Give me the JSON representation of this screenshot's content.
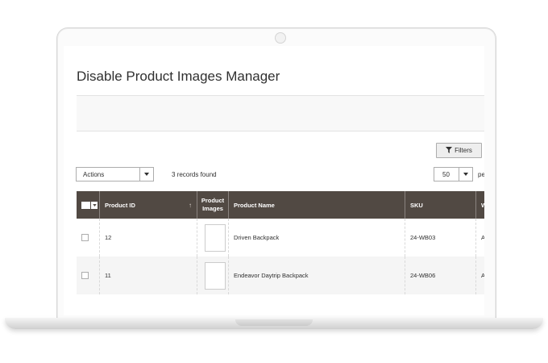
{
  "page": {
    "title": "Disable Product Images Manager"
  },
  "toolbar": {
    "filters_label": "Filters",
    "actions_value": "Actions",
    "records_text": "3 records found",
    "per_page_value": "50",
    "per_page_label": "pe"
  },
  "grid": {
    "columns": {
      "product_id": "Product ID",
      "product_images": "Product Images",
      "product_name": "Product Name",
      "sku": "SKU",
      "more": "W"
    },
    "sort_indicator": "↑",
    "rows": [
      {
        "id": "12",
        "name": "Driven Backpack",
        "sku": "24-WB03",
        "more": "A"
      },
      {
        "id": "11",
        "name": "Endeavor Daytrip Backpack",
        "sku": "24-WB06",
        "more": "A"
      }
    ]
  },
  "colors": {
    "header_bg": "#514943",
    "page_bg": "#ffffff",
    "band_bg": "#f8f8f8"
  },
  "icons": {
    "filter": "funnel-icon",
    "dropdown": "chevron-down-icon"
  }
}
